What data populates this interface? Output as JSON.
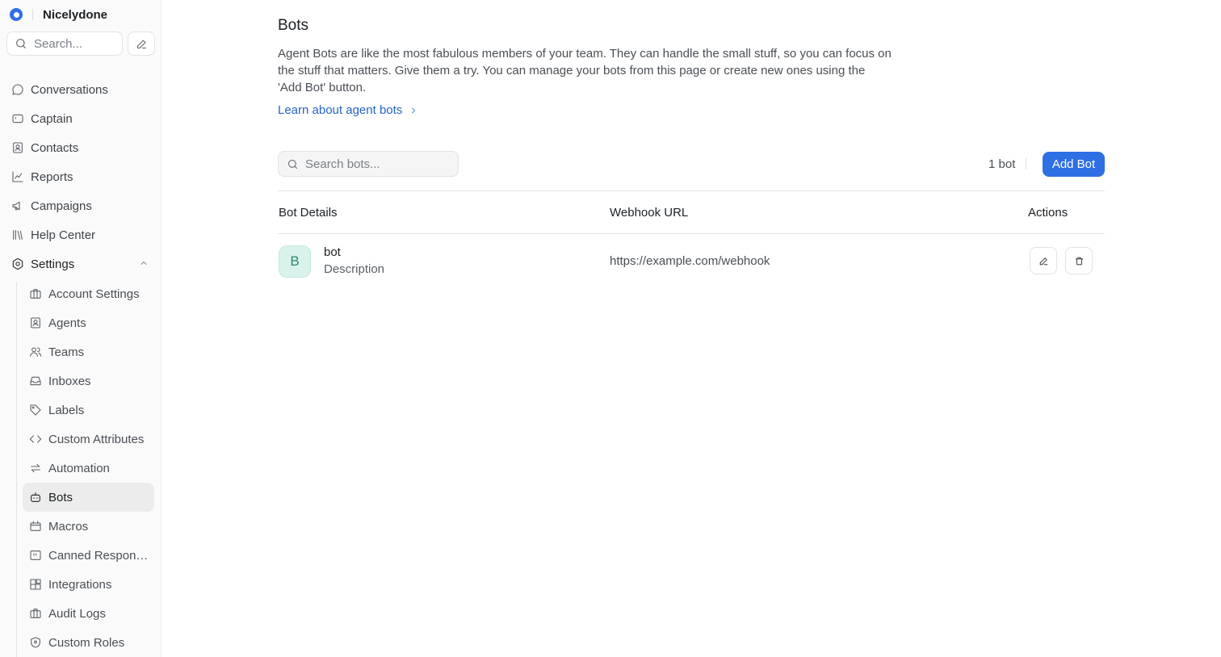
{
  "app": {
    "workspace_name": "Nicelydone"
  },
  "sidebar": {
    "search_placeholder": "Search...",
    "nav_items": [
      {
        "label": "Conversations",
        "icon": "chat-bubble-icon"
      },
      {
        "label": "Captain",
        "icon": "captain-icon"
      },
      {
        "label": "Contacts",
        "icon": "contacts-icon"
      },
      {
        "label": "Reports",
        "icon": "chart-line-icon"
      },
      {
        "label": "Campaigns",
        "icon": "megaphone-icon"
      },
      {
        "label": "Help Center",
        "icon": "library-icon"
      },
      {
        "label": "Settings",
        "icon": "gear-icon",
        "expanded": true
      }
    ],
    "settings_items": [
      {
        "label": "Account Settings",
        "icon": "briefcase-icon"
      },
      {
        "label": "Agents",
        "icon": "agent-icon"
      },
      {
        "label": "Teams",
        "icon": "users-icon"
      },
      {
        "label": "Inboxes",
        "icon": "inbox-icon"
      },
      {
        "label": "Labels",
        "icon": "tag-icon"
      },
      {
        "label": "Custom Attributes",
        "icon": "code-icon"
      },
      {
        "label": "Automation",
        "icon": "arrows-icon"
      },
      {
        "label": "Bots",
        "icon": "bot-icon",
        "active": true
      },
      {
        "label": "Macros",
        "icon": "macro-icon"
      },
      {
        "label": "Canned Responses",
        "icon": "canned-icon"
      },
      {
        "label": "Integrations",
        "icon": "integrations-icon"
      },
      {
        "label": "Audit Logs",
        "icon": "audit-icon"
      },
      {
        "label": "Custom Roles",
        "icon": "shield-icon"
      }
    ]
  },
  "page": {
    "title": "Bots",
    "description": "Agent Bots are like the most fabulous members of your team. They can handle the small stuff, so you can focus on the stuff that matters. Give them a try. You can manage your bots from this page or create new ones using the 'Add Bot' button.",
    "learn_link": "Learn about agent bots",
    "search_placeholder": "Search bots...",
    "count_label": "1 bot",
    "add_button": "Add Bot"
  },
  "table": {
    "headers": {
      "details": "Bot Details",
      "webhook": "Webhook URL",
      "actions": "Actions"
    },
    "rows": [
      {
        "avatar_letter": "B",
        "name": "bot",
        "description": "Description",
        "webhook_url": "https://example.com/webhook"
      }
    ]
  },
  "colors": {
    "accent": "#2f6fe4",
    "link": "#2463c8",
    "avatar_bg": "#d9f3ec",
    "avatar_text": "#2d8a70"
  }
}
